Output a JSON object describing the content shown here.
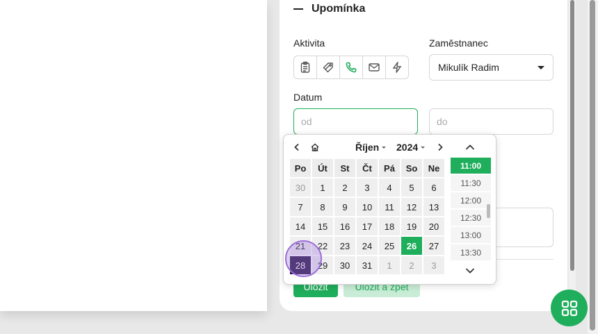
{
  "section": {
    "title": "Upomínka"
  },
  "labels": {
    "activity": "Aktivita",
    "employee": "Zaměstnanec",
    "date": "Datum"
  },
  "activity_icons": [
    "clipboard-icon",
    "tag-icon",
    "phone-icon",
    "mail-icon",
    "lightning-icon"
  ],
  "employee_select": {
    "value": "Mikulík Radim"
  },
  "date_inputs": {
    "from_placeholder": "od",
    "to_placeholder": "do"
  },
  "buttons": {
    "save": "Uložit",
    "save_back": "Uložit a zpět"
  },
  "picker": {
    "month": "Říjen",
    "year": "2024",
    "weekdays": [
      "Po",
      "Út",
      "St",
      "Čt",
      "Pá",
      "So",
      "Ne"
    ],
    "days": [
      {
        "d": "30",
        "m": true
      },
      {
        "d": "1"
      },
      {
        "d": "2"
      },
      {
        "d": "3"
      },
      {
        "d": "4"
      },
      {
        "d": "5"
      },
      {
        "d": "6"
      },
      {
        "d": "7"
      },
      {
        "d": "8"
      },
      {
        "d": "9"
      },
      {
        "d": "10"
      },
      {
        "d": "11"
      },
      {
        "d": "12"
      },
      {
        "d": "13"
      },
      {
        "d": "14"
      },
      {
        "d": "15"
      },
      {
        "d": "16"
      },
      {
        "d": "17"
      },
      {
        "d": "18"
      },
      {
        "d": "19"
      },
      {
        "d": "20"
      },
      {
        "d": "21"
      },
      {
        "d": "22"
      },
      {
        "d": "23"
      },
      {
        "d": "24"
      },
      {
        "d": "25"
      },
      {
        "d": "26",
        "today": true
      },
      {
        "d": "27"
      },
      {
        "d": "28",
        "selected": true
      },
      {
        "d": "29"
      },
      {
        "d": "30"
      },
      {
        "d": "31"
      },
      {
        "d": "1",
        "m": true
      },
      {
        "d": "2",
        "m": true
      },
      {
        "d": "3",
        "m": true
      }
    ],
    "times": [
      "11:00",
      "11:30",
      "12:00",
      "12:30",
      "13:00",
      "13:30"
    ],
    "active_time": "11:00"
  },
  "colors": {
    "accent": "#1fae5b",
    "selected_day": "#2a1a48"
  }
}
